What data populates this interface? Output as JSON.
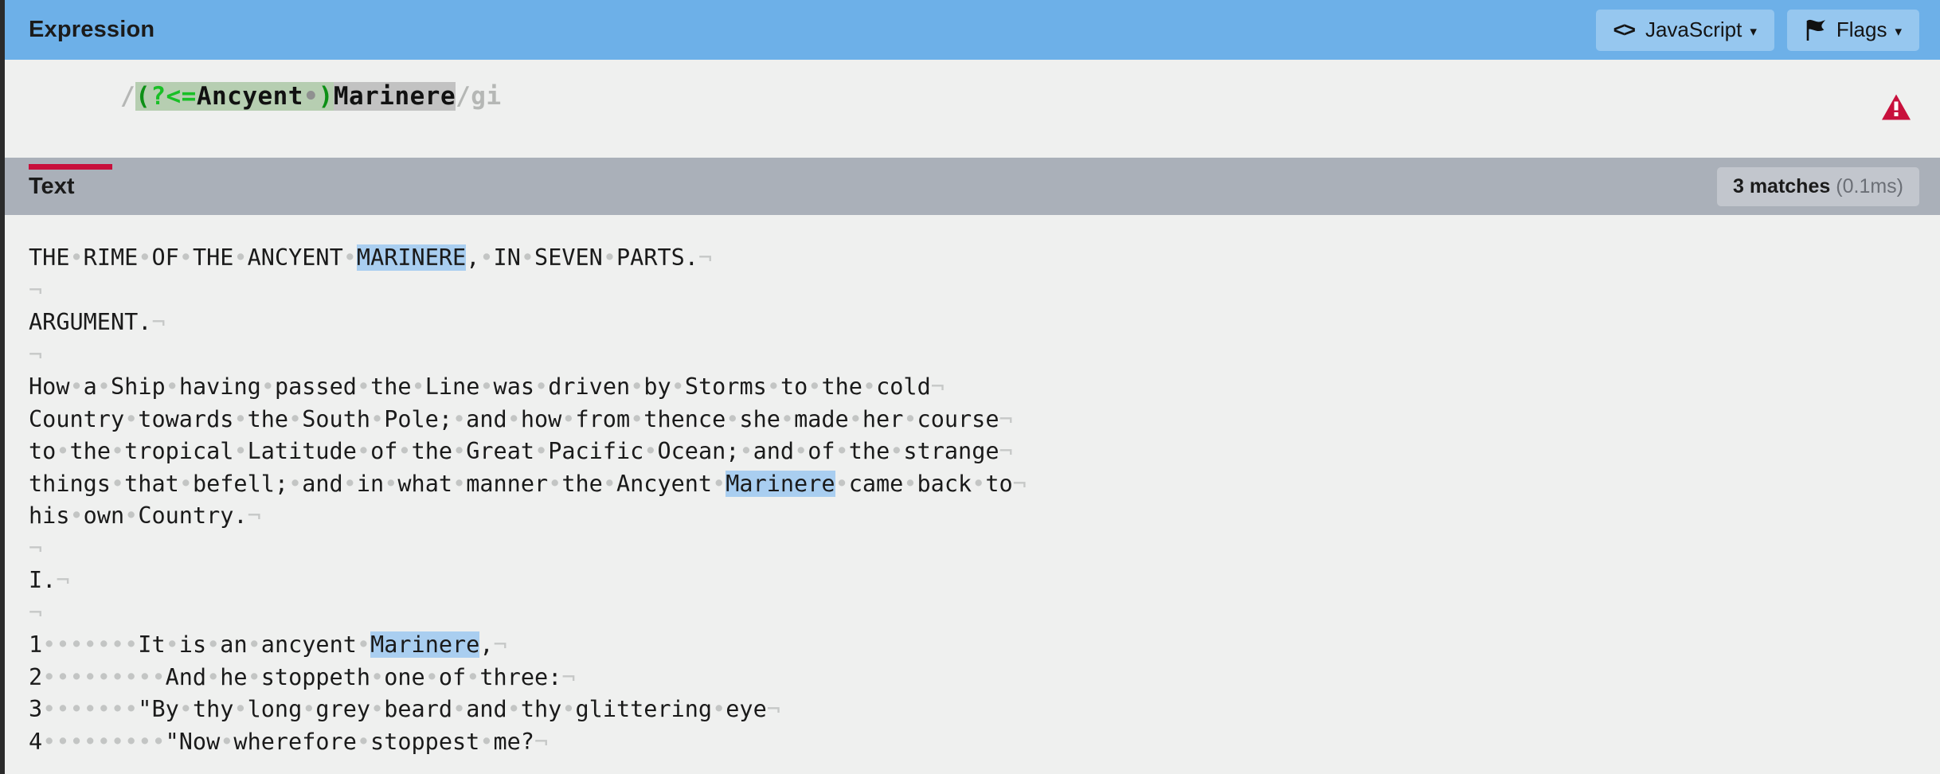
{
  "expression_panel": {
    "title": "Expression",
    "buttons": [
      {
        "name": "javascript",
        "icon": "code-icon",
        "label": "JavaScript",
        "caret": "▾"
      },
      {
        "name": "flags",
        "icon": "flag-icon",
        "label": "Flags",
        "caret": "▾"
      }
    ],
    "regex": {
      "open_delim": "/",
      "close_delim": "/",
      "flags": "gi",
      "lookbehind_open": "(",
      "lookbehind_meta": "?<=",
      "lookbehind_literal": "Ancyent",
      "lookbehind_space_dot": "•",
      "lookbehind_close": ")",
      "literal": "Marinere",
      "full": "/(?<=Ancyent )Marinere/gi"
    },
    "error_icon": "warning-triangle-icon",
    "error_underline_color": "#c8103c"
  },
  "text_panel": {
    "title": "Text",
    "match_count_label": "3 matches",
    "match_time_label": "(0.1ms)",
    "space_dot": "•",
    "newline_symbol": "¬",
    "lines": [
      {
        "segments": [
          {
            "t": "THE",
            "k": "x"
          },
          {
            "t": "•",
            "k": "sp"
          },
          {
            "t": "RIME",
            "k": "x"
          },
          {
            "t": "•",
            "k": "sp"
          },
          {
            "t": "OF",
            "k": "x"
          },
          {
            "t": "•",
            "k": "sp"
          },
          {
            "t": "THE",
            "k": "x"
          },
          {
            "t": "•",
            "k": "sp"
          },
          {
            "t": "ANCYENT",
            "k": "x"
          },
          {
            "t": "•",
            "k": "sp"
          },
          {
            "t": "MARINERE",
            "k": "m"
          },
          {
            "t": ",",
            "k": "x"
          },
          {
            "t": "•",
            "k": "sp"
          },
          {
            "t": "IN",
            "k": "x"
          },
          {
            "t": "•",
            "k": "sp"
          },
          {
            "t": "SEVEN",
            "k": "x"
          },
          {
            "t": "•",
            "k": "sp"
          },
          {
            "t": "PARTS.",
            "k": "x"
          },
          {
            "t": "¬",
            "k": "nl"
          }
        ]
      },
      {
        "segments": [
          {
            "t": "¬",
            "k": "nl"
          }
        ]
      },
      {
        "segments": [
          {
            "t": "ARGUMENT.",
            "k": "x"
          },
          {
            "t": "¬",
            "k": "nl"
          }
        ]
      },
      {
        "segments": [
          {
            "t": "¬",
            "k": "nl"
          }
        ]
      },
      {
        "segments": [
          {
            "t": "How",
            "k": "x"
          },
          {
            "t": "•",
            "k": "sp"
          },
          {
            "t": "a",
            "k": "x"
          },
          {
            "t": "•",
            "k": "sp"
          },
          {
            "t": "Ship",
            "k": "x"
          },
          {
            "t": "•",
            "k": "sp"
          },
          {
            "t": "having",
            "k": "x"
          },
          {
            "t": "•",
            "k": "sp"
          },
          {
            "t": "passed",
            "k": "x"
          },
          {
            "t": "•",
            "k": "sp"
          },
          {
            "t": "the",
            "k": "x"
          },
          {
            "t": "•",
            "k": "sp"
          },
          {
            "t": "Line",
            "k": "x"
          },
          {
            "t": "•",
            "k": "sp"
          },
          {
            "t": "was",
            "k": "x"
          },
          {
            "t": "•",
            "k": "sp"
          },
          {
            "t": "driven",
            "k": "x"
          },
          {
            "t": "•",
            "k": "sp"
          },
          {
            "t": "by",
            "k": "x"
          },
          {
            "t": "•",
            "k": "sp"
          },
          {
            "t": "Storms",
            "k": "x"
          },
          {
            "t": "•",
            "k": "sp"
          },
          {
            "t": "to",
            "k": "x"
          },
          {
            "t": "•",
            "k": "sp"
          },
          {
            "t": "the",
            "k": "x"
          },
          {
            "t": "•",
            "k": "sp"
          },
          {
            "t": "cold",
            "k": "x"
          },
          {
            "t": "¬",
            "k": "nl"
          }
        ]
      },
      {
        "segments": [
          {
            "t": "Country",
            "k": "x"
          },
          {
            "t": "•",
            "k": "sp"
          },
          {
            "t": "towards",
            "k": "x"
          },
          {
            "t": "•",
            "k": "sp"
          },
          {
            "t": "the",
            "k": "x"
          },
          {
            "t": "•",
            "k": "sp"
          },
          {
            "t": "South",
            "k": "x"
          },
          {
            "t": "•",
            "k": "sp"
          },
          {
            "t": "Pole;",
            "k": "x"
          },
          {
            "t": "•",
            "k": "sp"
          },
          {
            "t": "and",
            "k": "x"
          },
          {
            "t": "•",
            "k": "sp"
          },
          {
            "t": "how",
            "k": "x"
          },
          {
            "t": "•",
            "k": "sp"
          },
          {
            "t": "from",
            "k": "x"
          },
          {
            "t": "•",
            "k": "sp"
          },
          {
            "t": "thence",
            "k": "x"
          },
          {
            "t": "•",
            "k": "sp"
          },
          {
            "t": "she",
            "k": "x"
          },
          {
            "t": "•",
            "k": "sp"
          },
          {
            "t": "made",
            "k": "x"
          },
          {
            "t": "•",
            "k": "sp"
          },
          {
            "t": "her",
            "k": "x"
          },
          {
            "t": "•",
            "k": "sp"
          },
          {
            "t": "course",
            "k": "x"
          },
          {
            "t": "¬",
            "k": "nl"
          }
        ]
      },
      {
        "segments": [
          {
            "t": "to",
            "k": "x"
          },
          {
            "t": "•",
            "k": "sp"
          },
          {
            "t": "the",
            "k": "x"
          },
          {
            "t": "•",
            "k": "sp"
          },
          {
            "t": "tropical",
            "k": "x"
          },
          {
            "t": "•",
            "k": "sp"
          },
          {
            "t": "Latitude",
            "k": "x"
          },
          {
            "t": "•",
            "k": "sp"
          },
          {
            "t": "of",
            "k": "x"
          },
          {
            "t": "•",
            "k": "sp"
          },
          {
            "t": "the",
            "k": "x"
          },
          {
            "t": "•",
            "k": "sp"
          },
          {
            "t": "Great",
            "k": "x"
          },
          {
            "t": "•",
            "k": "sp"
          },
          {
            "t": "Pacific",
            "k": "x"
          },
          {
            "t": "•",
            "k": "sp"
          },
          {
            "t": "Ocean;",
            "k": "x"
          },
          {
            "t": "•",
            "k": "sp"
          },
          {
            "t": "and",
            "k": "x"
          },
          {
            "t": "•",
            "k": "sp"
          },
          {
            "t": "of",
            "k": "x"
          },
          {
            "t": "•",
            "k": "sp"
          },
          {
            "t": "the",
            "k": "x"
          },
          {
            "t": "•",
            "k": "sp"
          },
          {
            "t": "strange",
            "k": "x"
          },
          {
            "t": "¬",
            "k": "nl"
          }
        ]
      },
      {
        "segments": [
          {
            "t": "things",
            "k": "x"
          },
          {
            "t": "•",
            "k": "sp"
          },
          {
            "t": "that",
            "k": "x"
          },
          {
            "t": "•",
            "k": "sp"
          },
          {
            "t": "befell;",
            "k": "x"
          },
          {
            "t": "•",
            "k": "sp"
          },
          {
            "t": "and",
            "k": "x"
          },
          {
            "t": "•",
            "k": "sp"
          },
          {
            "t": "in",
            "k": "x"
          },
          {
            "t": "•",
            "k": "sp"
          },
          {
            "t": "what",
            "k": "x"
          },
          {
            "t": "•",
            "k": "sp"
          },
          {
            "t": "manner",
            "k": "x"
          },
          {
            "t": "•",
            "k": "sp"
          },
          {
            "t": "the",
            "k": "x"
          },
          {
            "t": "•",
            "k": "sp"
          },
          {
            "t": "Ancyent",
            "k": "x"
          },
          {
            "t": "•",
            "k": "sp"
          },
          {
            "t": "Marinere",
            "k": "m"
          },
          {
            "t": "•",
            "k": "sp"
          },
          {
            "t": "came",
            "k": "x"
          },
          {
            "t": "•",
            "k": "sp"
          },
          {
            "t": "back",
            "k": "x"
          },
          {
            "t": "•",
            "k": "sp"
          },
          {
            "t": "to",
            "k": "x"
          },
          {
            "t": "¬",
            "k": "nl"
          }
        ]
      },
      {
        "segments": [
          {
            "t": "his",
            "k": "x"
          },
          {
            "t": "•",
            "k": "sp"
          },
          {
            "t": "own",
            "k": "x"
          },
          {
            "t": "•",
            "k": "sp"
          },
          {
            "t": "Country.",
            "k": "x"
          },
          {
            "t": "¬",
            "k": "nl"
          }
        ]
      },
      {
        "segments": [
          {
            "t": "¬",
            "k": "nl"
          }
        ]
      },
      {
        "segments": [
          {
            "t": "I.",
            "k": "x"
          },
          {
            "t": "¬",
            "k": "nl"
          }
        ]
      },
      {
        "segments": [
          {
            "t": "¬",
            "k": "nl"
          }
        ]
      },
      {
        "segments": [
          {
            "t": "1",
            "k": "x"
          },
          {
            "t": "•••••••",
            "k": "sp"
          },
          {
            "t": "It",
            "k": "x"
          },
          {
            "t": "•",
            "k": "sp"
          },
          {
            "t": "is",
            "k": "x"
          },
          {
            "t": "•",
            "k": "sp"
          },
          {
            "t": "an",
            "k": "x"
          },
          {
            "t": "•",
            "k": "sp"
          },
          {
            "t": "ancyent",
            "k": "x"
          },
          {
            "t": "•",
            "k": "sp"
          },
          {
            "t": "Marinere",
            "k": "m"
          },
          {
            "t": ",",
            "k": "x"
          },
          {
            "t": "¬",
            "k": "nl"
          }
        ]
      },
      {
        "segments": [
          {
            "t": "2",
            "k": "x"
          },
          {
            "t": "•••••••••",
            "k": "sp"
          },
          {
            "t": "And",
            "k": "x"
          },
          {
            "t": "•",
            "k": "sp"
          },
          {
            "t": "he",
            "k": "x"
          },
          {
            "t": "•",
            "k": "sp"
          },
          {
            "t": "stoppeth",
            "k": "x"
          },
          {
            "t": "•",
            "k": "sp"
          },
          {
            "t": "one",
            "k": "x"
          },
          {
            "t": "•",
            "k": "sp"
          },
          {
            "t": "of",
            "k": "x"
          },
          {
            "t": "•",
            "k": "sp"
          },
          {
            "t": "three:",
            "k": "x"
          },
          {
            "t": "¬",
            "k": "nl"
          }
        ]
      },
      {
        "segments": [
          {
            "t": "3",
            "k": "x"
          },
          {
            "t": "•••••••",
            "k": "sp"
          },
          {
            "t": "\"By",
            "k": "x"
          },
          {
            "t": "•",
            "k": "sp"
          },
          {
            "t": "thy",
            "k": "x"
          },
          {
            "t": "•",
            "k": "sp"
          },
          {
            "t": "long",
            "k": "x"
          },
          {
            "t": "•",
            "k": "sp"
          },
          {
            "t": "grey",
            "k": "x"
          },
          {
            "t": "•",
            "k": "sp"
          },
          {
            "t": "beard",
            "k": "x"
          },
          {
            "t": "•",
            "k": "sp"
          },
          {
            "t": "and",
            "k": "x"
          },
          {
            "t": "•",
            "k": "sp"
          },
          {
            "t": "thy",
            "k": "x"
          },
          {
            "t": "•",
            "k": "sp"
          },
          {
            "t": "glittering",
            "k": "x"
          },
          {
            "t": "•",
            "k": "sp"
          },
          {
            "t": "eye",
            "k": "x"
          },
          {
            "t": "¬",
            "k": "nl"
          }
        ]
      },
      {
        "segments": [
          {
            "t": "4",
            "k": "x"
          },
          {
            "t": "•••••••••",
            "k": "sp"
          },
          {
            "t": "\"Now",
            "k": "x"
          },
          {
            "t": "•",
            "k": "sp"
          },
          {
            "t": "wherefore",
            "k": "x"
          },
          {
            "t": "•",
            "k": "sp"
          },
          {
            "t": "stoppest",
            "k": "x"
          },
          {
            "t": "•",
            "k": "sp"
          },
          {
            "t": "me?",
            "k": "x"
          },
          {
            "t": "¬",
            "k": "nl"
          }
        ]
      }
    ]
  },
  "colors": {
    "expression_header_bg": "#6db0e8",
    "text_header_bg": "#aab0b9",
    "page_bg": "#eff0ef",
    "match_highlight": "#a9cef0",
    "group_highlight": "#b6ceb1",
    "error_red": "#c8103c"
  }
}
